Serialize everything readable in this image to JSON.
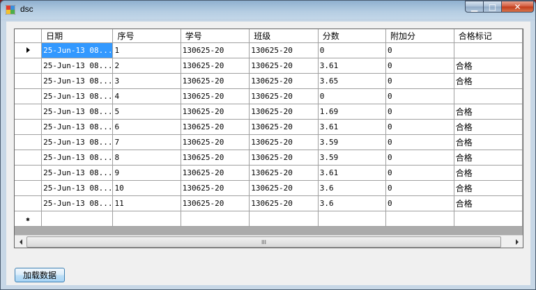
{
  "window": {
    "title": "dsc",
    "minimize_glyph": "▁",
    "maximize_glyph": "□",
    "close_glyph": "✕"
  },
  "grid": {
    "columns": [
      "日期",
      "序号",
      "学号",
      "班级",
      "分数",
      "附加分",
      "合格标记"
    ],
    "rows": [
      [
        "25-Jun-13 08...",
        "1",
        "130625-20",
        "130625-20",
        "0",
        "0",
        ""
      ],
      [
        "25-Jun-13 08...",
        "2",
        "130625-20",
        "130625-20",
        "3.61",
        "0",
        "合格"
      ],
      [
        "25-Jun-13 08...",
        "3",
        "130625-20",
        "130625-20",
        "3.65",
        "0",
        "合格"
      ],
      [
        "25-Jun-13 08...",
        "4",
        "130625-20",
        "130625-20",
        "0",
        "0",
        ""
      ],
      [
        "25-Jun-13 08...",
        "5",
        "130625-20",
        "130625-20",
        "1.69",
        "0",
        "合格"
      ],
      [
        "25-Jun-13 08...",
        "6",
        "130625-20",
        "130625-20",
        "3.61",
        "0",
        "合格"
      ],
      [
        "25-Jun-13 08...",
        "7",
        "130625-20",
        "130625-20",
        "3.59",
        "0",
        "合格"
      ],
      [
        "25-Jun-13 08...",
        "8",
        "130625-20",
        "130625-20",
        "3.59",
        "0",
        "合格"
      ],
      [
        "25-Jun-13 08...",
        "9",
        "130625-20",
        "130625-20",
        "3.61",
        "0",
        "合格"
      ],
      [
        "25-Jun-13 08...",
        "10",
        "130625-20",
        "130625-20",
        "3.6",
        "0",
        "合格"
      ],
      [
        "25-Jun-13 08...",
        "11",
        "130625-20",
        "130625-20",
        "3.6",
        "0",
        "合格"
      ]
    ],
    "current_row_icon": "row-arrow-icon",
    "new_row_icon": "new-row-star-icon",
    "new_row_glyph": "✱",
    "scroll_thumb_glyph": "III"
  },
  "buttons": {
    "load_label": "加载数据"
  },
  "colors": {
    "selection": "#3399ff",
    "grid_background": "#ababab"
  }
}
